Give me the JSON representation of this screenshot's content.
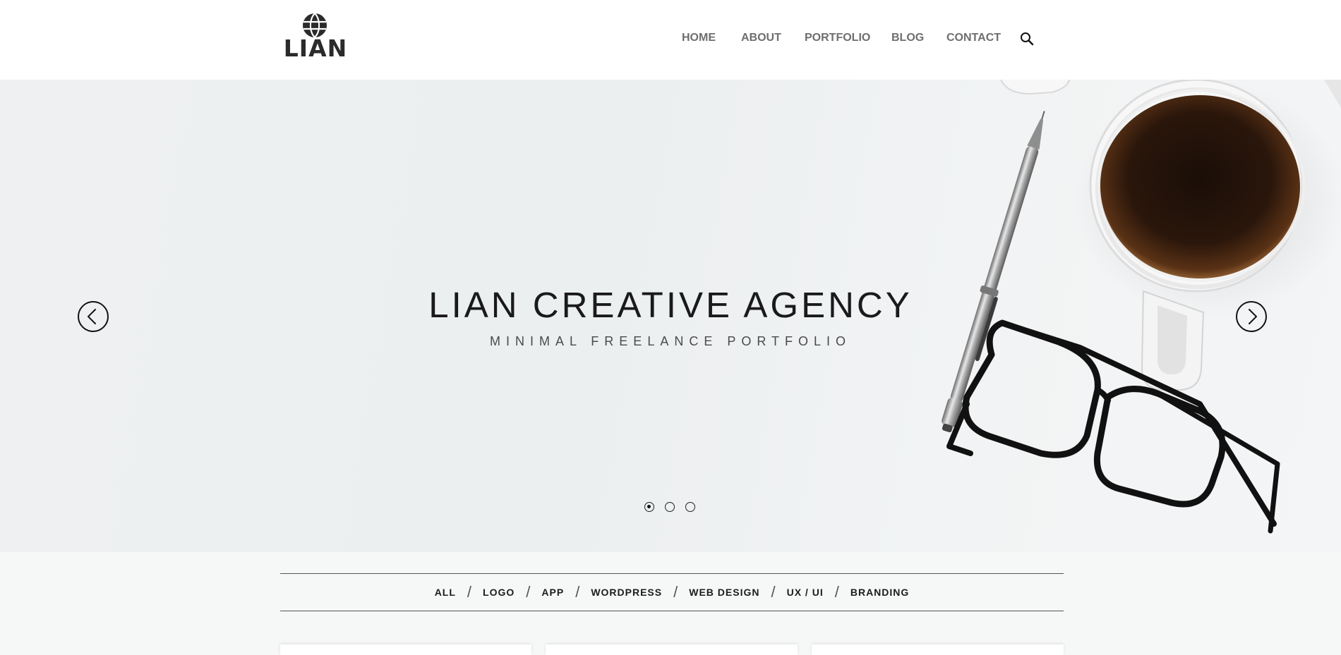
{
  "header": {
    "logo_text": "LIAN",
    "nav": [
      {
        "label": "HOME"
      },
      {
        "label": "ABOUT"
      },
      {
        "label": "PORTFOLIO"
      },
      {
        "label": "BLOG"
      },
      {
        "label": "CONTACT"
      }
    ],
    "search_icon": "search-icon"
  },
  "hero": {
    "title": "LIAN CREATIVE AGENCY",
    "subtitle": "MINIMAL FREELANCE PORTFOLIO",
    "prev_icon": "chevron-left-icon",
    "next_icon": "chevron-right-icon",
    "slides_total": 3,
    "active_slide": 1
  },
  "filters": [
    {
      "label": "ALL"
    },
    {
      "label": "LOGO"
    },
    {
      "label": "APP"
    },
    {
      "label": "WORDPRESS"
    },
    {
      "label": "WEB DESIGN"
    },
    {
      "label": "UX / UI"
    },
    {
      "label": "BRANDING"
    }
  ],
  "colors": {
    "text_dark": "#1a1a1a",
    "nav_text": "#6e6e6e",
    "page_bg": "#f6f7f7"
  }
}
